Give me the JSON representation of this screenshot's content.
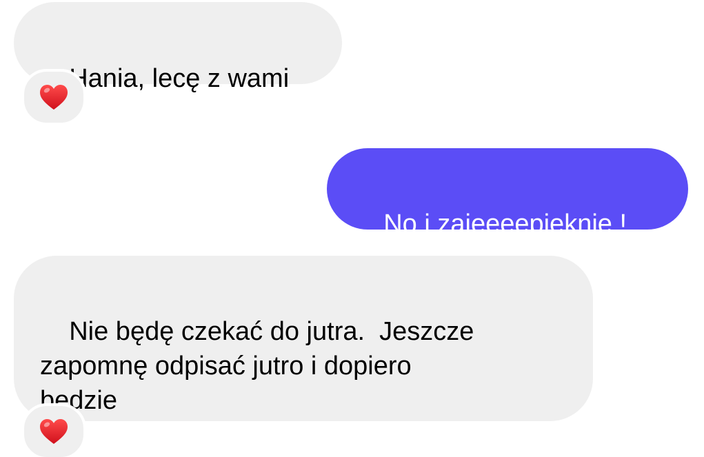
{
  "messages": [
    {
      "direction": "incoming",
      "text": "Hania, lecę z wami",
      "reaction": "heart-icon"
    },
    {
      "direction": "outgoing",
      "text": "No i zajeeeepieknie !"
    },
    {
      "direction": "incoming",
      "text": "Nie będę czekać do jutra.  Jeszcze\nzapomnę odpisać jutro i dopiero\nbedzie",
      "reaction": "heart-icon"
    }
  ],
  "colors": {
    "incoming_bubble": "#efefef",
    "outgoing_bubble": "#5b4df6",
    "reaction_heart": "#e8202a"
  }
}
